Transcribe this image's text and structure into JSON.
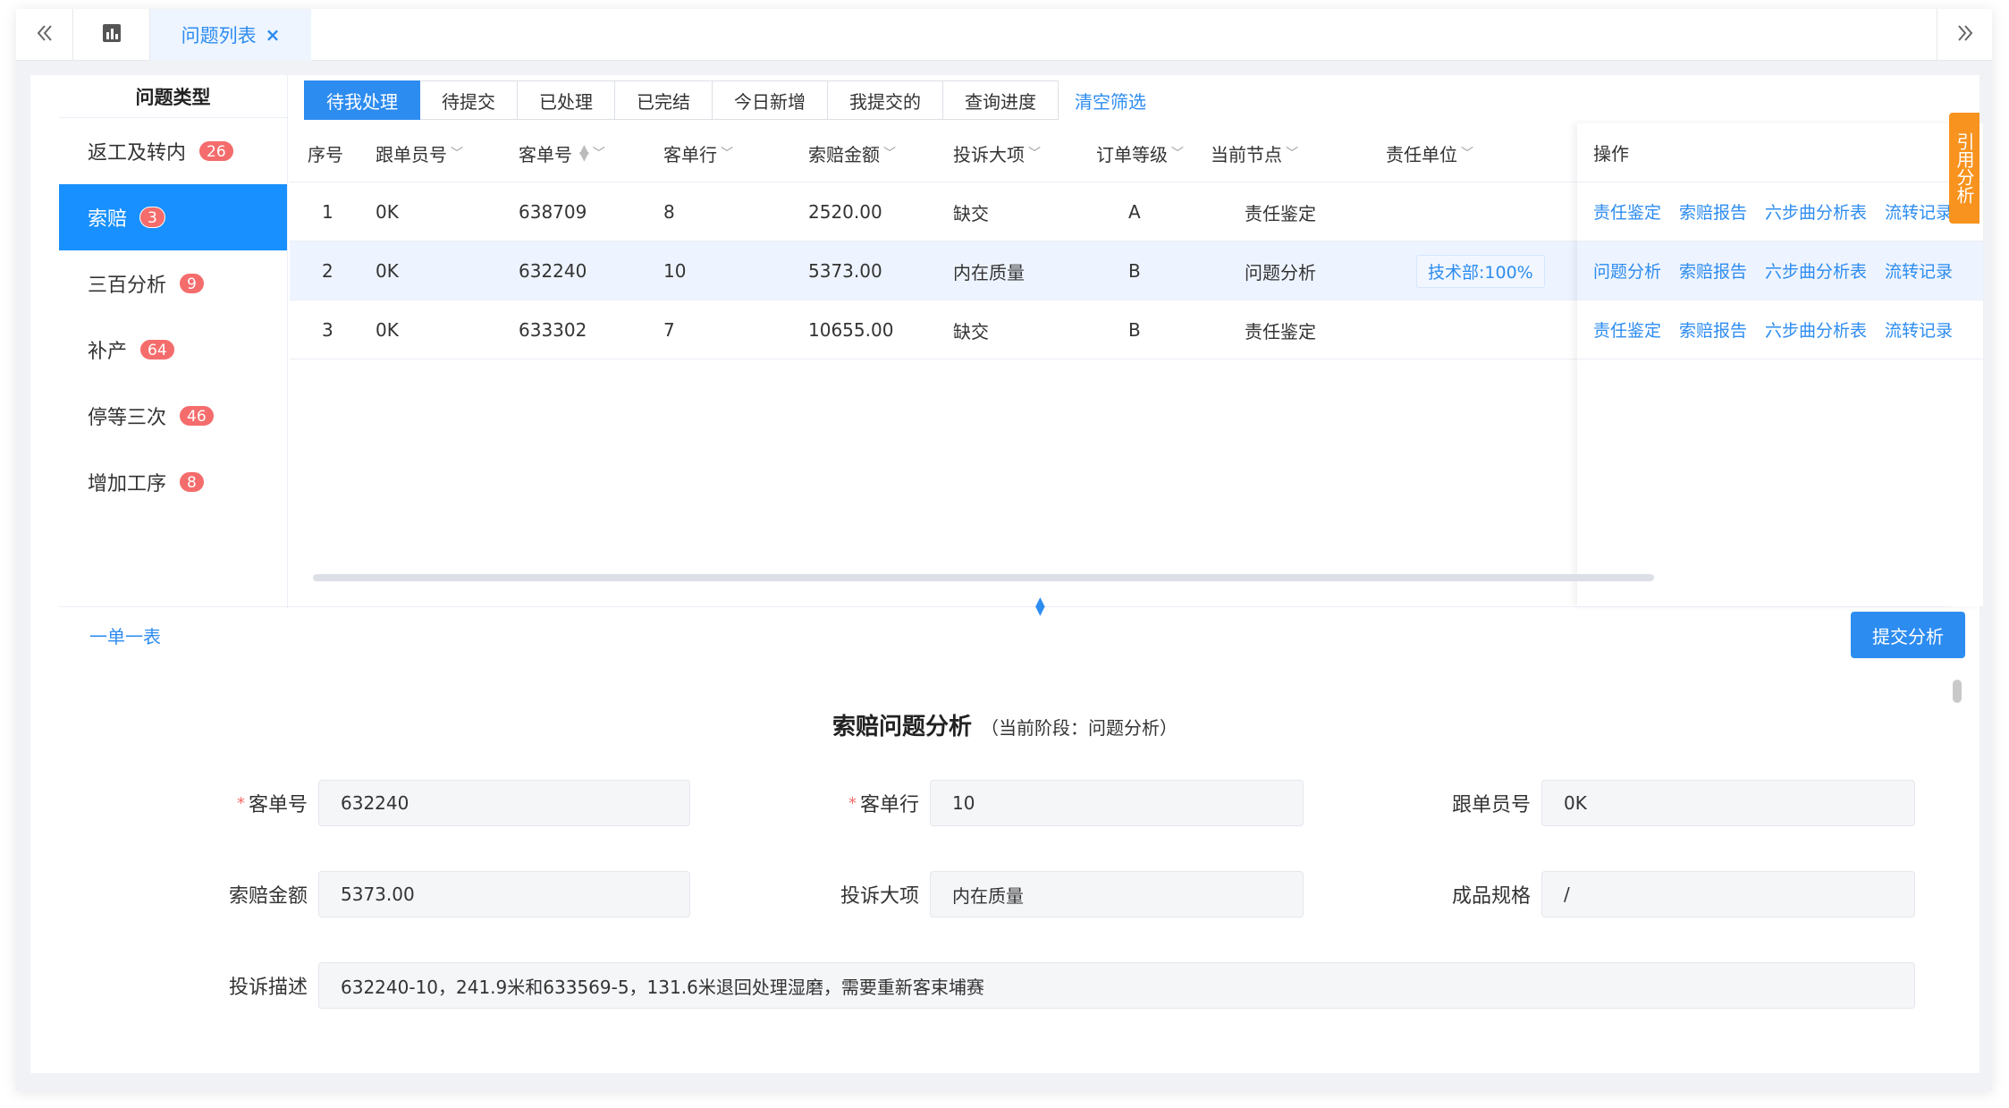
{
  "tabbar": {
    "active_tab": "问题列表",
    "close_glyph": "×",
    "left_glyph": "《",
    "right_glyph": "》"
  },
  "sidebar": {
    "title": "问题类型",
    "items": [
      {
        "label": "返工及转内",
        "count": "26"
      },
      {
        "label": "索赔",
        "count": "3"
      },
      {
        "label": "三百分析",
        "count": "9"
      },
      {
        "label": "补产",
        "count": "64"
      },
      {
        "label": "停等三次",
        "count": "46"
      },
      {
        "label": "增加工序",
        "count": "8"
      }
    ]
  },
  "filters": {
    "tabs": [
      "待我处理",
      "待提交",
      "已处理",
      "已完结",
      "今日新增",
      "我提交的",
      "查询进度"
    ],
    "clear": "清空筛选"
  },
  "table": {
    "headers": [
      "序号",
      "跟单员号",
      "客单号",
      "客单行",
      "索赔金额",
      "投诉大项",
      "订单等级",
      "当前节点",
      "责任单位",
      "操作"
    ],
    "rows": [
      {
        "no": "1",
        "follower": "0K",
        "order": "638709",
        "line": "8",
        "amount": "2520.00",
        "item": "缺交",
        "level": "A",
        "node": "责任鉴定",
        "unit": "",
        "ops": [
          "责任鉴定",
          "索赔报告",
          "六步曲分析表",
          "流转记录"
        ]
      },
      {
        "no": "2",
        "follower": "0K",
        "order": "632240",
        "line": "10",
        "amount": "5373.00",
        "item": "内在质量",
        "level": "B",
        "node": "问题分析",
        "unit": "技术部:100%",
        "ops": [
          "问题分析",
          "索赔报告",
          "六步曲分析表",
          "流转记录"
        ]
      },
      {
        "no": "3",
        "follower": "0K",
        "order": "633302",
        "line": "7",
        "amount": "10655.00",
        "item": "缺交",
        "level": "B",
        "node": "责任鉴定",
        "unit": "",
        "ops": [
          "责任鉴定",
          "索赔报告",
          "六步曲分析表",
          "流转记录"
        ]
      }
    ]
  },
  "side_tab": "引用分析",
  "bottom": {
    "link": "一单一表",
    "submit": "提交分析"
  },
  "form": {
    "title": "索赔问题分析",
    "subtitle": "（当前阶段：问题分析）",
    "fields": {
      "order_label": "客单号",
      "order_value": "632240",
      "line_label": "客单行",
      "line_value": "10",
      "follower_label": "跟单员号",
      "follower_value": "0K",
      "amount_label": "索赔金额",
      "amount_value": "5373.00",
      "item_label": "投诉大项",
      "item_value": "内在质量",
      "spec_label": "成品规格",
      "spec_value": "/",
      "desc_label": "投诉描述",
      "desc_value": "632240-10，241.9米和633569-5，131.6米退回处理湿磨，需要重新客束埔赛"
    }
  },
  "colors": {
    "accent": "#2d8cf0",
    "badge": "#f56c6c",
    "side_tab": "#f7931e"
  }
}
